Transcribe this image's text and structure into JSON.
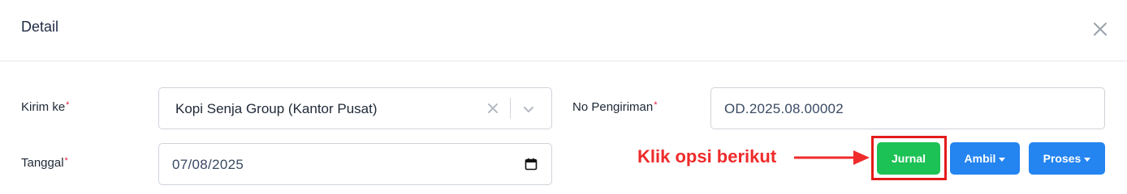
{
  "header": {
    "title": "Detail",
    "close_icon": "close-icon"
  },
  "form": {
    "kirim_ke": {
      "label": "Kirim ke",
      "required_mark": "*",
      "value": "Kopi Senja Group (Kantor Pusat)"
    },
    "tanggal": {
      "label": "Tanggal",
      "required_mark": "*",
      "value": "07/08/2025"
    },
    "no_pengiriman": {
      "label": "No Pengiriman",
      "required_mark": "*",
      "value": "OD.2025.08.00002"
    }
  },
  "annotation": {
    "text": "Klik opsi berikut",
    "color": "#ef2b2b"
  },
  "actions": {
    "jurnal": {
      "label": "Jurnal",
      "color": "#1cc255"
    },
    "ambil": {
      "label": "Ambil",
      "color": "#2484f0"
    },
    "proses": {
      "label": "Proses",
      "color": "#2484f0"
    }
  }
}
